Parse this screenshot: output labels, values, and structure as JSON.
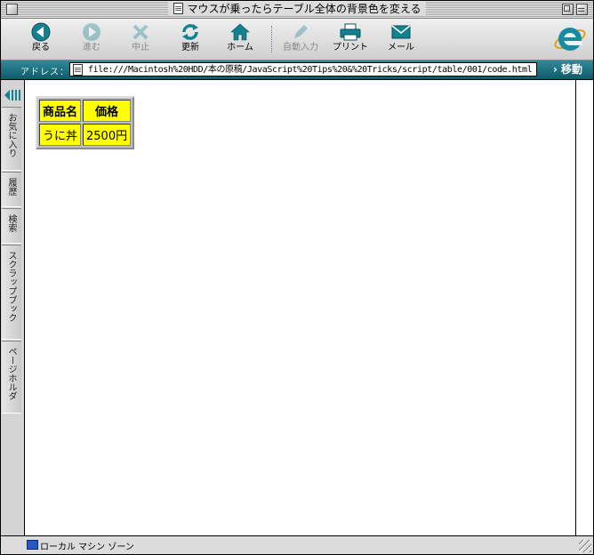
{
  "window": {
    "title": "マウスが乗ったらテーブル全体の背景色を変える"
  },
  "toolbar": {
    "back_label": "戻る",
    "forward_label": "進む",
    "stop_label": "中止",
    "refresh_label": "更新",
    "home_label": "ホーム",
    "autofill_label": "自動入力",
    "print_label": "プリント",
    "mail_label": "メール"
  },
  "address": {
    "label": "アドレス：",
    "url": "file:///Macintosh%20HDD/本の原稿/JavaScript%20Tips%20&%20Tricks/script/table/001/code.html",
    "go_label": "移動"
  },
  "explorer_tabs": {
    "favorites": "お気に入り",
    "history": "履歴",
    "search": "検索",
    "scrapbook": "スクラップブック",
    "page_holder": "ページホルダ"
  },
  "table": {
    "headers": [
      "商品名",
      "価格"
    ],
    "rows": [
      [
        "うに丼",
        "2500円"
      ]
    ]
  },
  "status": {
    "zone": "ローカル マシン ゾーン"
  },
  "colors": {
    "table_bg": "#ffff00",
    "address_bar": "#1e6f7e",
    "accent_icon": "#138290"
  }
}
